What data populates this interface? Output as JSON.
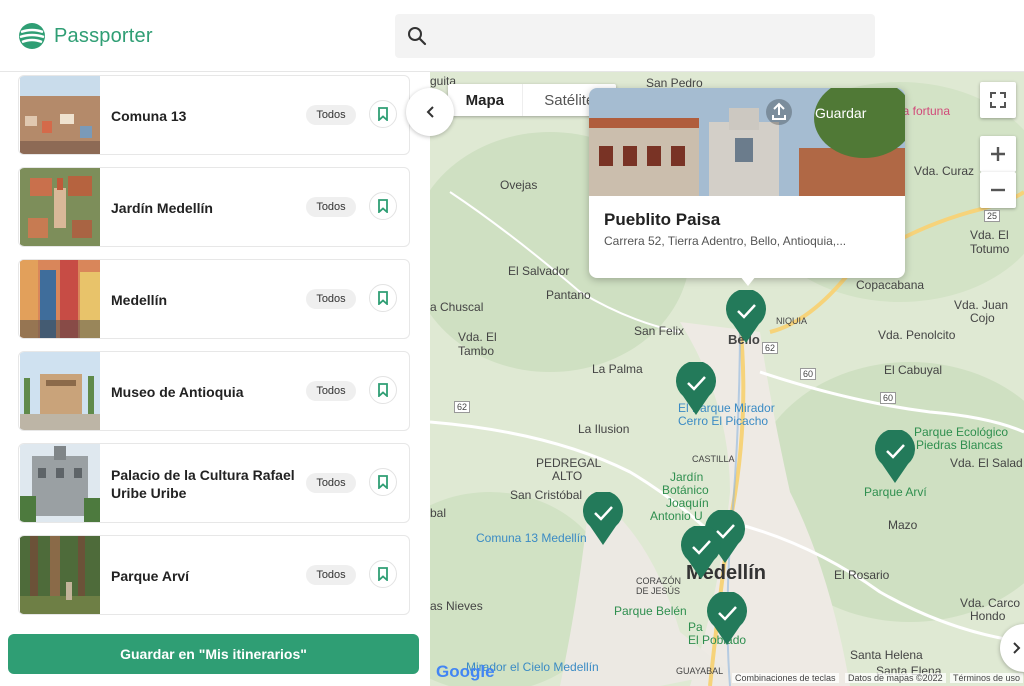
{
  "app": {
    "name": "Passporter",
    "brand_color": "#2f9e74"
  },
  "places": [
    {
      "title": "Comuna 13",
      "chip": "Todos"
    },
    {
      "title": "Jardín Medellín",
      "chip": "Todos"
    },
    {
      "title": "Medellín",
      "chip": "Todos"
    },
    {
      "title": "Museo de Antioquia",
      "chip": "Todos"
    },
    {
      "title": "Palacio de la Cultura Rafael Uribe Uribe",
      "chip": "Todos"
    },
    {
      "title": "Parque Arví",
      "chip": "Todos"
    }
  ],
  "save_itinerary_label": "Guardar en \"Mis itinerarios\"",
  "map": {
    "type_map": "Mapa",
    "type_satellite": "Satélite",
    "popup": {
      "title": "Pueblito Paisa",
      "address": "Carrera 52, Tierra Adentro, Bello, Antioquia,...",
      "save_label": "Guardar"
    },
    "labels": {
      "guita": "guita",
      "san_pedro": "San Pedro",
      "fortuna": "la fortuna",
      "ovejas": "Ovejas",
      "curaza": "Vda. Curaz",
      "el_salvador": "El Salvador",
      "pantano": "Pantano",
      "chuscal": "a Chuscal",
      "vda_el_tambo_1": "Vda. El",
      "vda_el_tambo_2": "Tambo",
      "san_felix": "San Felix",
      "la_palma": "La Palma",
      "la_ilusion": "La Ilusion",
      "pedregal_1": "PEDREGAL",
      "pedregal_2": "ALTO",
      "san_cristobal": "San Cristóbal",
      "copacabana": "Copacabana",
      "juan_cojo_1": "Vda. Juan",
      "juan_cojo_2": "Cojo",
      "penolcito": "Vda. Penolcito",
      "el_cabuyal": "El Cabuyal",
      "el_totumo_1": "Vda. El",
      "el_totumo_2": "Totumo",
      "piedras_blancas_1": "Parque Ecológico",
      "piedras_blancas_2": "Piedras Blancas",
      "el_salado": "Vda. El Salad",
      "parque_arvi": "Parque Arví",
      "mazo": "Mazo",
      "el_rosario": "El Rosario",
      "carco_hondo_1": "Vda. Carco",
      "carco_hondo_2": "Hondo",
      "santa_helena": "Santa Helena",
      "santa_elena": "Santa Elena",
      "bello": "Bello",
      "niquia": "NIQUIA",
      "castilla": "CASTILLA",
      "mirador_1": "El Parque Mirador",
      "mirador_2": "Cerro El Picacho",
      "jardin_1": "Jardín",
      "jardin_2": "Botánico",
      "jardin_3": "Joaquín",
      "jardin_4": "Antonio U",
      "comuna13": "Comuna 13 Medellín",
      "corazon_1": "CORAZÓN",
      "corazon_2": "DE JESÚS",
      "medellin": "Medellín",
      "nieves": "as Nieves",
      "parque_belen": "Parque Belén",
      "poblado_1": "Pa",
      "poblado_2": "El Poblado",
      "mirador_cielo": "Mirador el Cielo Medellín",
      "guayabal": "GUAYABAL",
      "sbal": "bal",
      "road_25": "25",
      "road_62": "62",
      "road_60": "60"
    },
    "footer": {
      "shortcuts": "Combinaciones de teclas",
      "map_data": "Datos de mapas ©2022",
      "terms": "Términos de uso"
    },
    "google": "Google"
  }
}
